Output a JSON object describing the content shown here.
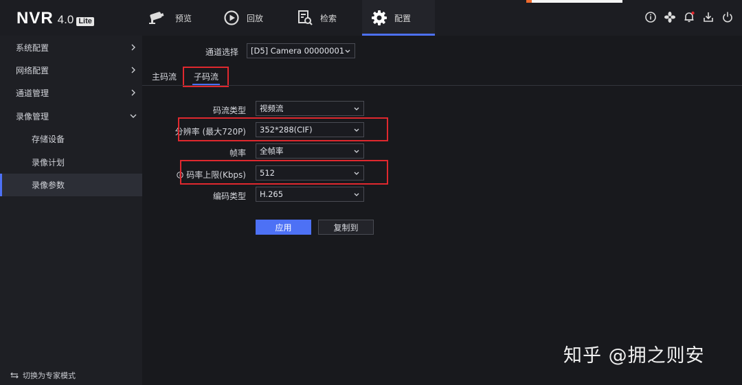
{
  "app": {
    "logo_main": "NVR",
    "logo_version": "4.0",
    "logo_badge": "Lite"
  },
  "nav": {
    "tabs": [
      {
        "label": "预览",
        "icon": "camera-icon"
      },
      {
        "label": "回放",
        "icon": "playback-icon"
      },
      {
        "label": "检索",
        "icon": "search-doc-icon"
      },
      {
        "label": "配置",
        "icon": "gear-icon",
        "active": true
      }
    ],
    "right_icons": [
      "info-icon",
      "fan-icon",
      "bell-icon",
      "download-icon",
      "power-icon"
    ]
  },
  "sidebar": {
    "items": [
      {
        "label": "系统配置",
        "expanded": false
      },
      {
        "label": "网络配置",
        "expanded": false
      },
      {
        "label": "通道管理",
        "expanded": false
      },
      {
        "label": "录像管理",
        "expanded": true
      },
      {
        "label": "存储设备",
        "sub": true
      },
      {
        "label": "录像计划",
        "sub": true
      },
      {
        "label": "录像参数",
        "sub": true,
        "active": true
      }
    ],
    "expert_mode": "切换为专家模式"
  },
  "main": {
    "channel_label": "通道选择",
    "channel_value": "[D5] Camera 00000001",
    "tabs": [
      {
        "label": "主码流"
      },
      {
        "label": "子码流",
        "active": true
      }
    ],
    "fields": [
      {
        "label": "码流类型",
        "value": "视频流"
      },
      {
        "label": "分辨率 (最大720P)",
        "value": "352*288(CIF)",
        "highlighted": true
      },
      {
        "label": "帧率",
        "value": "全帧率"
      },
      {
        "label": "码率上限(Kbps)",
        "value": "512",
        "highlighted": true,
        "info_icon": true
      },
      {
        "label": "编码类型",
        "value": "H.265"
      }
    ],
    "apply_button": "应用",
    "copy_button": "复制到"
  },
  "watermark": "知乎 @拥之则安",
  "colors": {
    "accent": "#4d71f5",
    "highlight_box": "#e0282e",
    "background": "#18191d",
    "sidebar_bg": "#1e1f24"
  }
}
